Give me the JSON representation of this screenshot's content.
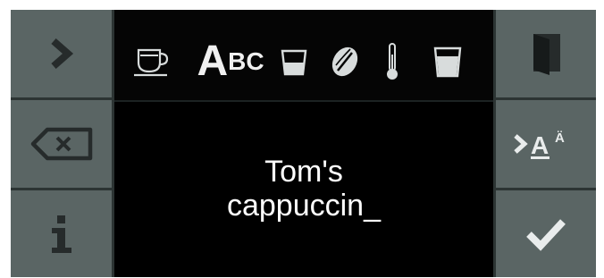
{
  "display": {
    "name_lines": [
      "Tom's",
      "cappuccin_"
    ]
  },
  "icon_strip": {
    "items": [
      "cup-icon",
      "text-abc-icon",
      "cup-small-icon",
      "coffee-bean-icon",
      "thermometer-icon",
      "glass-icon"
    ],
    "abc_big": "A",
    "abc_small": "BC"
  },
  "buttons": {
    "left": [
      "next-arrow-icon",
      "backspace-icon",
      "info-icon"
    ],
    "right": [
      "exit-door-icon",
      "letter-case-icon",
      "confirm-check-icon"
    ],
    "info_glyph": "i",
    "letter_case_label": "A",
    "letter_case_sup": "Ä"
  },
  "colors": {
    "button_face": "#5a6564",
    "icon_dark": "#262b2b",
    "icon_light": "#e9ecec",
    "display_bg": "#000000",
    "text": "#ffffff"
  }
}
